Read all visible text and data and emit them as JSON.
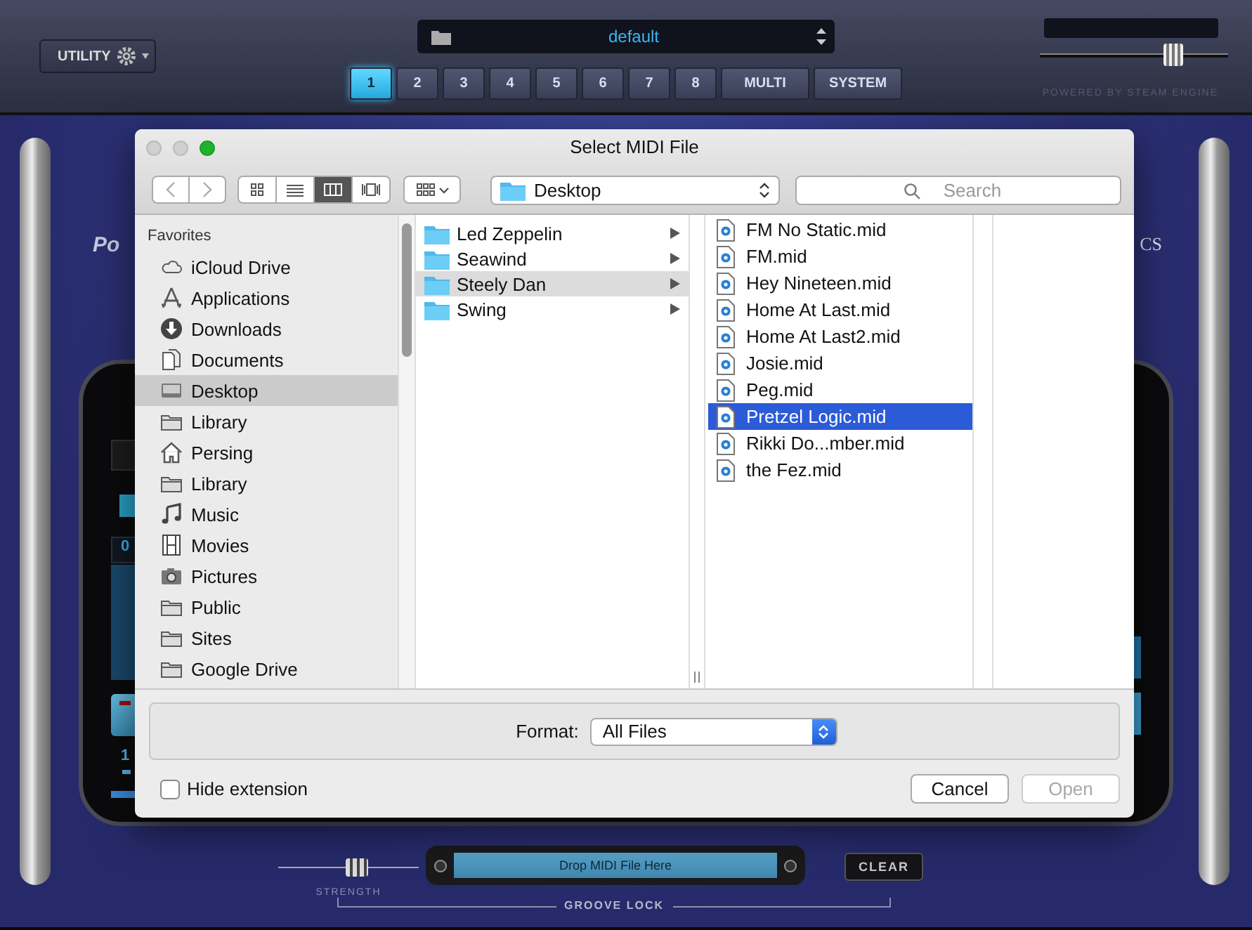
{
  "app": {
    "utility_button": "UTILITY",
    "preset": "default",
    "parts": [
      {
        "label": "1",
        "selected": true
      },
      {
        "label": "2",
        "selected": false
      },
      {
        "label": "3",
        "selected": false
      },
      {
        "label": "4",
        "selected": false
      },
      {
        "label": "5",
        "selected": false
      },
      {
        "label": "6",
        "selected": false
      },
      {
        "label": "7",
        "selected": false
      },
      {
        "label": "8",
        "selected": false
      },
      {
        "label": "MULTI",
        "selected": false
      },
      {
        "label": "SYSTEM",
        "selected": false
      }
    ],
    "volume": {
      "level": 0.73
    },
    "powered_by": "POWERED BY STEAM ENGINE"
  },
  "background": {
    "logo_left": "Po",
    "logo_right": "CS",
    "readout": "0",
    "channel": "1"
  },
  "groove": {
    "strength": {
      "label": "STRENGTH",
      "level": 0.57
    },
    "drop_zone": "Drop MIDI File Here",
    "clear_button": "CLEAR",
    "title": "GROOVE LOCK"
  },
  "dialog": {
    "title": "Select MIDI File",
    "view_modes": [
      {
        "kind": "icons",
        "selected": false
      },
      {
        "kind": "list",
        "selected": false
      },
      {
        "kind": "columns",
        "selected": true
      },
      {
        "kind": "coverflow",
        "selected": false
      }
    ],
    "location": "Desktop",
    "search": {
      "placeholder": "Search"
    },
    "sidebar": {
      "heading": "Favorites",
      "items": [
        {
          "label": "iCloud Drive",
          "kind": "cloud",
          "selected": false
        },
        {
          "label": "Applications",
          "kind": "apps",
          "selected": false
        },
        {
          "label": "Downloads",
          "kind": "download",
          "selected": false
        },
        {
          "label": "Documents",
          "kind": "document",
          "selected": false
        },
        {
          "label": "Desktop",
          "kind": "desktop",
          "selected": true
        },
        {
          "label": "Library",
          "kind": "folder",
          "selected": false
        },
        {
          "label": "Persing",
          "kind": "home",
          "selected": false
        },
        {
          "label": "Library",
          "kind": "folder",
          "selected": false
        },
        {
          "label": "Music",
          "kind": "music",
          "selected": false
        },
        {
          "label": "Movies",
          "kind": "movie",
          "selected": false
        },
        {
          "label": "Pictures",
          "kind": "camera",
          "selected": false
        },
        {
          "label": "Public",
          "kind": "folder",
          "selected": false
        },
        {
          "label": "Sites",
          "kind": "folder",
          "selected": false
        },
        {
          "label": "Google Drive",
          "kind": "folder",
          "selected": false
        }
      ]
    },
    "folders": [
      {
        "name": "Led Zeppelin",
        "selected": false
      },
      {
        "name": "Seawind",
        "selected": false
      },
      {
        "name": "Steely Dan",
        "selected": true
      },
      {
        "name": "Swing",
        "selected": false
      }
    ],
    "files": [
      {
        "name": "FM No Static.mid",
        "selected": false
      },
      {
        "name": "FM.mid",
        "selected": false
      },
      {
        "name": "Hey Nineteen.mid",
        "selected": false
      },
      {
        "name": "Home At Last.mid",
        "selected": false
      },
      {
        "name": "Home At Last2.mid",
        "selected": false
      },
      {
        "name": "Josie.mid",
        "selected": false
      },
      {
        "name": "Peg.mid",
        "selected": false
      },
      {
        "name": "Pretzel Logic.mid",
        "selected": true
      },
      {
        "name": "Rikki Do...mber.mid",
        "selected": false
      },
      {
        "name": "the Fez.mid",
        "selected": false
      }
    ],
    "format": {
      "label": "Format:",
      "value": "All Files"
    },
    "hide_extension": {
      "label": "Hide extension",
      "checked": false
    },
    "buttons": [
      {
        "label": "Cancel",
        "disabled": false
      },
      {
        "label": "Open",
        "disabled": true
      }
    ]
  }
}
